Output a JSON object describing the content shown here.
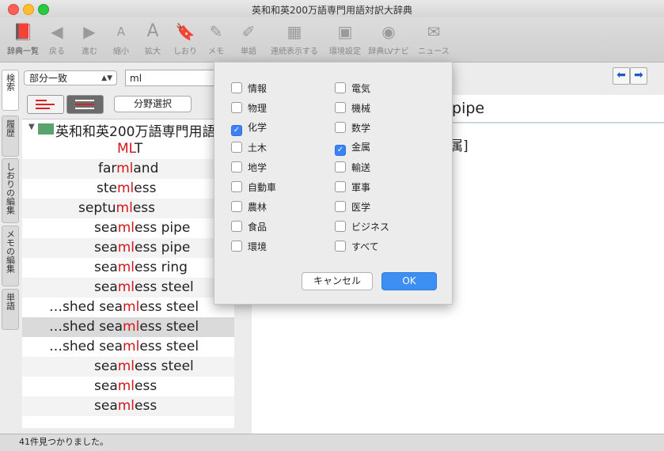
{
  "window": {
    "title": "英和和英200万語専門用語対訳大辞典"
  },
  "toolbar": [
    {
      "label": "辞典一覧",
      "icon": "book-icon",
      "active": true
    },
    {
      "label": "戻る",
      "icon": "back-arrow-icon",
      "active": false
    },
    {
      "label": "進む",
      "icon": "forward-arrow-icon",
      "active": false
    },
    {
      "label": "縮小",
      "icon": "font-smaller-icon",
      "active": false
    },
    {
      "label": "拡大",
      "icon": "font-larger-icon",
      "active": false
    },
    {
      "label": "しおり",
      "icon": "bookmark-icon",
      "active": false
    },
    {
      "label": "メモ",
      "icon": "memo-icon",
      "active": false
    },
    {
      "label": "単語",
      "icon": "word-icon",
      "active": false
    },
    {
      "label": "連続表示する",
      "icon": "continuous-display-icon",
      "active": false
    },
    {
      "label": "環境設定",
      "icon": "settings-icon",
      "active": false
    },
    {
      "label": "辞典LVナビ",
      "icon": "lv-navi-icon",
      "active": false
    },
    {
      "label": "ニュース",
      "icon": "mailbox-icon",
      "active": false
    }
  ],
  "side_tabs": [
    {
      "label": "検索",
      "selected": true
    },
    {
      "label": "履歴",
      "selected": false
    },
    {
      "label": "しおりの編集",
      "selected": false
    },
    {
      "label": "メモの編集",
      "selected": false
    },
    {
      "label": "単語",
      "selected": false
    }
  ],
  "search": {
    "mode": "部分一致",
    "query": "ml",
    "field_button": "分野選択"
  },
  "results": {
    "dictionary": "英和和英200万語専門用語",
    "rows": [
      {
        "pre": "",
        "hit": "ML",
        "post": "T"
      },
      {
        "pre": "far",
        "hit": "ml",
        "post": "and"
      },
      {
        "pre": "ste",
        "hit": "ml",
        "post": "ess"
      },
      {
        "pre": "septu",
        "hit": "ml",
        "post": "ess"
      },
      {
        "pre": "sea",
        "hit": "ml",
        "post": "ess pipe"
      },
      {
        "pre": "sea",
        "hit": "ml",
        "post": "ess pipe"
      },
      {
        "pre": "sea",
        "hit": "ml",
        "post": "ess ring"
      },
      {
        "pre": "sea",
        "hit": "ml",
        "post": "ess steel"
      },
      {
        "pre": "…shed sea",
        "hit": "ml",
        "post": "ess steel"
      },
      {
        "pre": "…shed sea",
        "hit": "ml",
        "post": "ess steel"
      },
      {
        "pre": "…shed sea",
        "hit": "ml",
        "post": "ess steel"
      },
      {
        "pre": "sea",
        "hit": "ml",
        "post": "ess steel"
      },
      {
        "pre": "sea",
        "hit": "ml",
        "post": "ess"
      },
      {
        "pre": "sea",
        "hit": "ml",
        "post": "ess"
      }
    ]
  },
  "detail": {
    "headword": "el pipe",
    "body": "属]"
  },
  "status": "41件見つかりました。",
  "field_dialog": {
    "left": [
      {
        "label": "情報",
        "checked": false
      },
      {
        "label": "物理",
        "checked": false
      },
      {
        "label": "化学",
        "checked": true
      },
      {
        "label": "土木",
        "checked": false
      },
      {
        "label": "地学",
        "checked": false
      },
      {
        "label": "自動車",
        "checked": false
      },
      {
        "label": "農林",
        "checked": false
      },
      {
        "label": "食品",
        "checked": false
      },
      {
        "label": "環境",
        "checked": false
      }
    ],
    "right": [
      {
        "label": "電気",
        "checked": false
      },
      {
        "label": "機械",
        "checked": false
      },
      {
        "label": "数学",
        "checked": false
      },
      {
        "label": "金属",
        "checked": true
      },
      {
        "label": "輸送",
        "checked": false
      },
      {
        "label": "軍事",
        "checked": false
      },
      {
        "label": "医学",
        "checked": false
      },
      {
        "label": "ビジネス",
        "checked": false
      },
      {
        "label": "すべて",
        "checked": false
      }
    ],
    "cancel": "キャンセル",
    "ok": "OK"
  }
}
